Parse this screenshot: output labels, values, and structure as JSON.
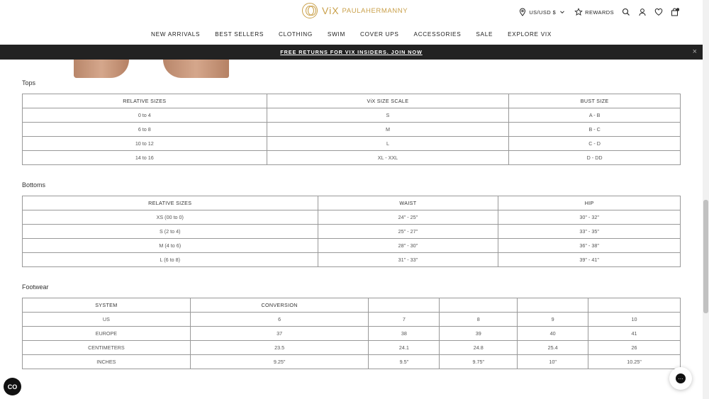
{
  "header": {
    "logo_mark": "ViX",
    "logo_sub": "PAULAHERMANNY",
    "locale": "US/USD $",
    "rewards": "REWARDS",
    "cart_count": ""
  },
  "nav": {
    "items": [
      "NEW ARRIVALS",
      "BEST SELLERS",
      "CLOTHING",
      "SWIM",
      "COVER UPS",
      "ACCESSORIES",
      "SALE",
      "EXPLORE VIX"
    ]
  },
  "promo": {
    "text": "FREE RETURNS FOR VIX INSIDERS. JOIN NOW",
    "close": "×"
  },
  "tops": {
    "title": "Tops",
    "headers": [
      "RELATIVE SIZES",
      "ViX SIZE SCALE",
      "BUST SIZE"
    ],
    "rows": [
      [
        "0 to 4",
        "S",
        "A - B"
      ],
      [
        "6 to 8",
        "M",
        "B - C"
      ],
      [
        "10 to 12",
        "L",
        "C - D"
      ],
      [
        "14 to 16",
        "XL - XXL",
        "D - DD"
      ]
    ]
  },
  "bottoms": {
    "title": "Bottoms",
    "headers": [
      "RELATIVE SIZES",
      "WAIST",
      "HIP"
    ],
    "rows": [
      [
        "XS (00 to 0)",
        "24\" - 25\"",
        "30\" - 32\""
      ],
      [
        "S (2 to 4)",
        "25\" - 27\"",
        "33\" - 35\""
      ],
      [
        "M (4 to 6)",
        "28\" - 30\"",
        "36\" - 38\""
      ],
      [
        "L (6 to 8)",
        "31\" - 33\"",
        "39\" - 41\""
      ]
    ]
  },
  "footwear": {
    "title": "Footwear",
    "headers": [
      "SYSTEM",
      "CONVERSION",
      "",
      "",
      "",
      ""
    ],
    "rows": [
      [
        "US",
        "6",
        "7",
        "8",
        "9",
        "10"
      ],
      [
        "EUROPE",
        "37",
        "38",
        "39",
        "40",
        "41"
      ],
      [
        "CENTIMETERS",
        "23.5",
        "24.1",
        "24.8",
        "25.4",
        "26"
      ],
      [
        "INCHES",
        "9.25\"",
        "9.5\"",
        "9.75\"",
        "10\"",
        "10.25\""
      ]
    ]
  },
  "widgets": {
    "accessibility_label": "CO"
  },
  "colors": {
    "brand_gold": "#c9a04a",
    "promo_bg": "#222222",
    "table_border": "#999999"
  }
}
